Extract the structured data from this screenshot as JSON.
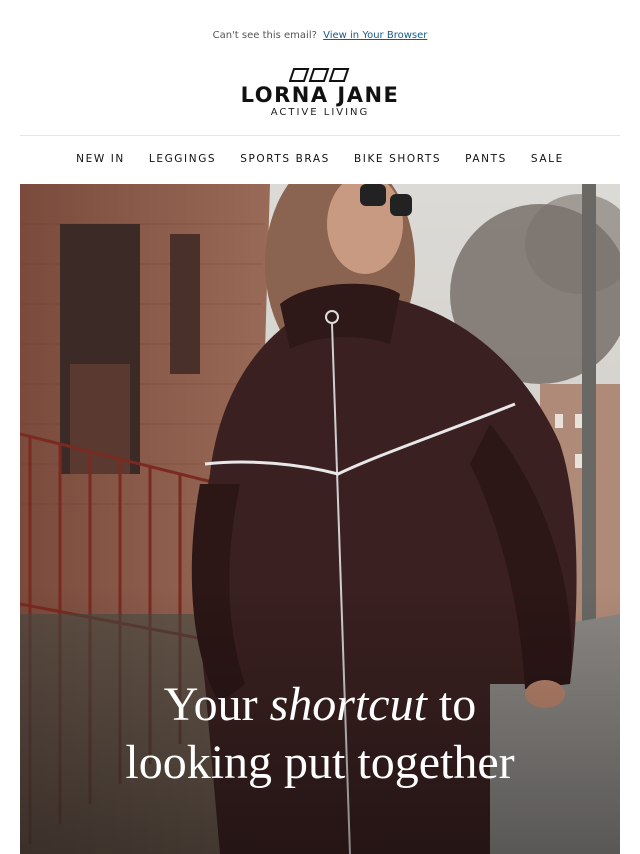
{
  "preheader": {
    "text": "Can't see this email?",
    "link": "View in Your Browser"
  },
  "brand": {
    "name": "LORNA JANE",
    "tagline": "ACTIVE LIVING"
  },
  "nav": [
    {
      "label": "NEW IN"
    },
    {
      "label": "LEGGINGS"
    },
    {
      "label": "SPORTS BRAS"
    },
    {
      "label": "BIKE SHORTS"
    },
    {
      "label": "PANTS"
    },
    {
      "label": "SALE"
    }
  ],
  "hero": {
    "headline_part1": "Your",
    "headline_emphasis": "shortcut",
    "headline_part2": "to",
    "headline_line2": "looking put together"
  },
  "colors": {
    "link": "#1a5a8a",
    "brick": "#8a5a4a",
    "jacket": "#3a2020",
    "sky": "#d8d6d2"
  }
}
